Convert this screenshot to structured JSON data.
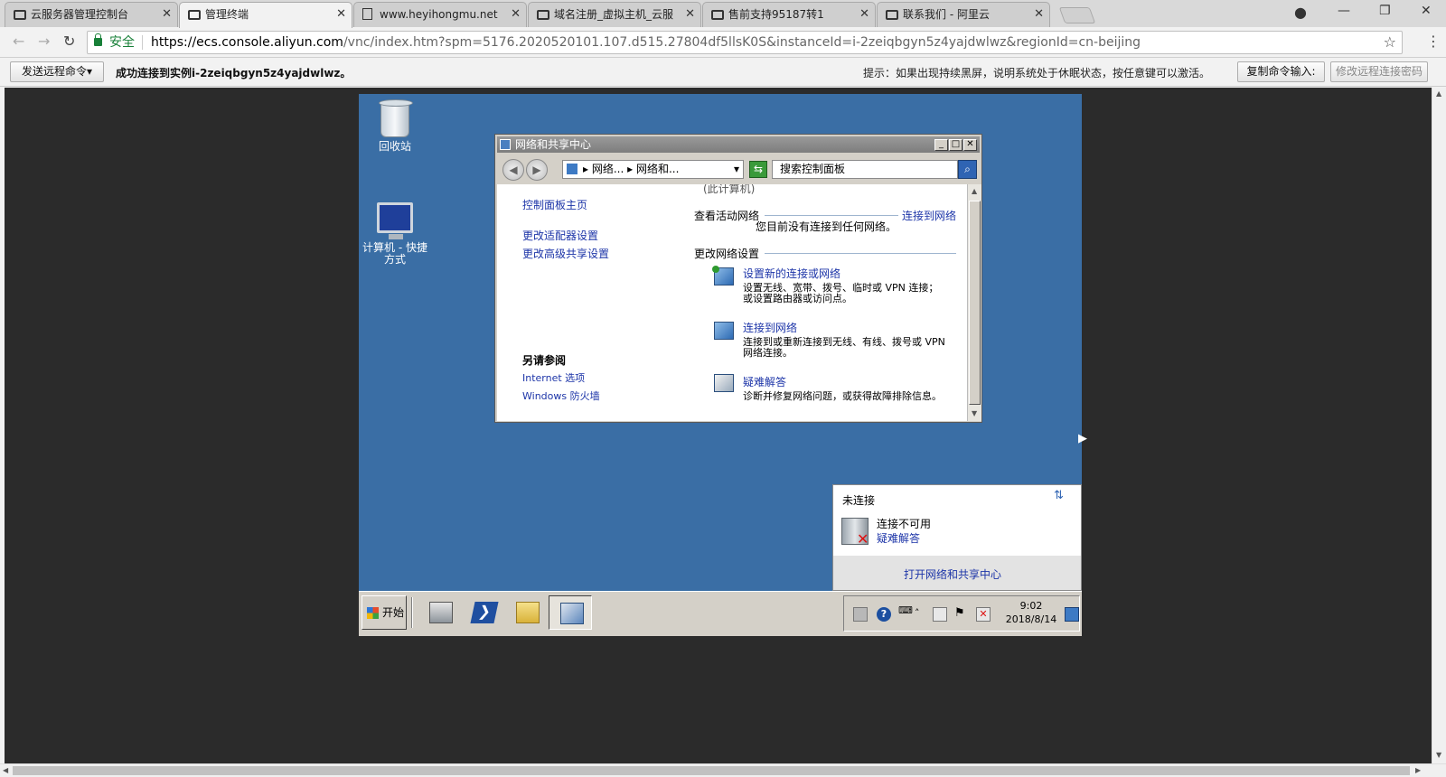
{
  "browser": {
    "tabs": [
      {
        "title": "云服务器管理控制台",
        "icon": "remote-icon",
        "active": false
      },
      {
        "title": "管理终端",
        "icon": "remote-icon",
        "active": true
      },
      {
        "title": "www.heyihongmu.net",
        "icon": "page-icon",
        "active": false
      },
      {
        "title": "域名注册_虚拟主机_云服",
        "icon": "remote-icon",
        "active": false
      },
      {
        "title": "售前支持95187转1",
        "icon": "remote-icon",
        "active": false
      },
      {
        "title": "联系我们 - 阿里云",
        "icon": "remote-icon",
        "active": false
      }
    ],
    "security_label": "安全",
    "url_host": "https://ecs.console.aliyun.com",
    "url_rest": "/vnc/index.htm?spm=5176.2020520101.107.d515.27804df5llsK0S&instanceId=i-2zeiqbgyn5z4yajdwlwz&regionId=cn-beijing"
  },
  "vnc": {
    "send_command_label": "发送远程命令",
    "connection_status": "成功连接到实例i-2zeiqbgyn5z4yajdwlwz。",
    "hint": "提示：如果出现持续黑屏，说明系统处于休眠状态，按任意键可以激活。",
    "copy_command_label": "复制命令输入:",
    "change_password_label": "修改远程连接密码"
  },
  "desktop": {
    "icons": [
      {
        "label": "回收站",
        "icon": "recycle-bin-icon"
      },
      {
        "label": "计算机 - 快捷方式",
        "icon": "computer-shortcut-icon"
      }
    ]
  },
  "window": {
    "title": "网络和共享中心",
    "crumb_1": "网络...",
    "crumb_2": "网络和...",
    "search_placeholder": "搜索控制面板",
    "left_links": [
      "控制面板主页",
      "更改适配器设置",
      "更改高级共享设置"
    ],
    "see_also_heading": "另请参阅",
    "see_also_links": [
      "Internet 选项",
      "Windows 防火墙"
    ],
    "clipped_top_text": "(此计算机)",
    "active_network_heading": "查看活动网络",
    "no_network_text": "您目前没有连接到任何网络。",
    "connect_link": "连接到网络",
    "change_settings_heading": "更改网络设置",
    "tasks": [
      {
        "title": "设置新的连接或网络",
        "desc_1": "设置无线、宽带、拨号、临时或 VPN 连接；",
        "desc_2": "或设置路由器或访问点。",
        "icon": "new-connection-icon"
      },
      {
        "title": "连接到网络",
        "desc_1": "连接到或重新连接到无线、有线、拨号或 VPN",
        "desc_2": "网络连接。",
        "icon": "connect-network-icon"
      },
      {
        "title": "疑难解答",
        "desc_1": "诊断并修复网络问题，或获得故障排除信息。",
        "desc_2": "",
        "icon": "troubleshoot-icon"
      }
    ]
  },
  "popup": {
    "title": "未连接",
    "status": "连接不可用",
    "troubleshoot_link": "疑难解答",
    "footer_link": "打开网络和共享中心"
  },
  "taskbar": {
    "start_label": "开始",
    "time": "9:02",
    "date": "2018/8/14"
  }
}
